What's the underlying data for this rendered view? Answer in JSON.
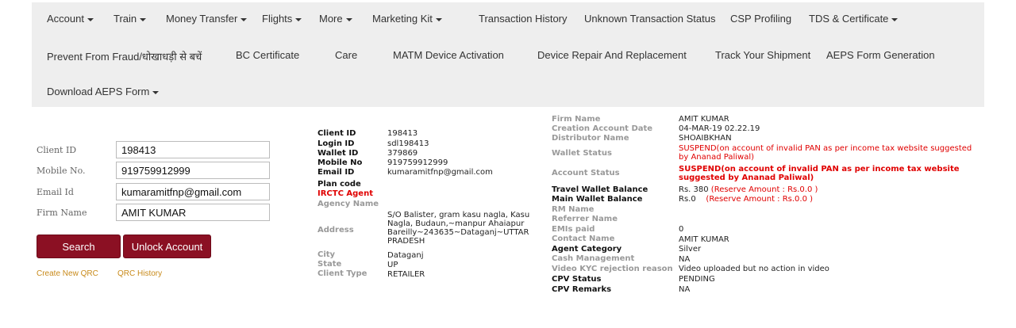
{
  "nav": {
    "row1": [
      {
        "label": "Account",
        "caret": true
      },
      {
        "label": "Train",
        "caret": true
      },
      {
        "label": "Money Transfer",
        "caret": true
      },
      {
        "label": "Flights",
        "caret": true
      },
      {
        "label": "More",
        "caret": true
      },
      {
        "label": "Marketing Kit",
        "caret": true
      },
      {
        "label": "Transaction History",
        "caret": false
      },
      {
        "label": "Unknown Transaction Status",
        "caret": false
      },
      {
        "label": "CSP Profiling",
        "caret": false
      },
      {
        "label": "TDS & Certificate",
        "caret": true
      }
    ],
    "row2": [
      {
        "label": "Prevent From Fraud/धोखाधड़ी से बचें"
      },
      {
        "label": "BC Certificate"
      },
      {
        "label": "Care"
      },
      {
        "label": "MATM Device Activation"
      },
      {
        "label": "Device Repair And Replacement"
      },
      {
        "label": "Track Your Shipment"
      },
      {
        "label": "AEPS Form Generation"
      }
    ],
    "row3": [
      {
        "label": "Download AEPS Form",
        "caret": true
      }
    ]
  },
  "search_form": {
    "client_id_label": "Client ID",
    "client_id_value": "198413",
    "mobile_label": "Mobile No.",
    "mobile_value": "919759912999",
    "email_label": "Email Id",
    "email_value": "kumaramitfnp@gmail.com",
    "firm_label": "Firm Name",
    "firm_value": "AMIT KUMAR",
    "search_button": "Search",
    "unlock_button": "Unlock Account",
    "create_qrc_link": "Create New QRC",
    "qrc_history_link": "QRC History"
  },
  "details_mid": {
    "client_id_k": "Client ID",
    "client_id_v": "198413",
    "login_id_k": "Login ID",
    "login_id_v": "sdl198413",
    "wallet_id_k": "Wallet ID",
    "wallet_id_v": "379869",
    "mobile_k": "Mobile No",
    "mobile_v": "919759912999",
    "email_k": "Email ID",
    "email_v": "kumaramitfnp@gmail.com",
    "plan_k": "Plan code",
    "irctc_k": "IRCTC Agent",
    "agency_k": "Agency Name",
    "address_k": "Address",
    "address_v": "S/O Balister, gram kasu nagla, Kasu Nagla, Budaun,~manpur Ahaiapur Bareilly~243635~Dataganj~UTTAR PRADESH",
    "city_k": "City",
    "city_v": "Dataganj",
    "state_k": "State",
    "state_v": "UP",
    "client_type_k": "Client Type",
    "client_type_v": "RETAILER"
  },
  "details_right": {
    "firm_k": "Firm Name",
    "firm_v": "AMIT KUMAR",
    "creation_k": "Creation Account Date",
    "creation_v": "04-MAR-19 02.22.19",
    "distributor_k": "Distributor Name",
    "distributor_v": "SHOAIBKHAN",
    "wallet_status_k": "Wallet Status",
    "wallet_status_v": "SUSPEND(on account of invalid PAN as per income tax website suggested by Ananad Paliwal)",
    "account_status_k": "Account Status",
    "account_status_v": "SUSPEND(on account of invalid PAN as per income tax website suggested by Ananad Paliwal)",
    "travel_k": "Travel Wallet Balance",
    "travel_v": "Rs. 380",
    "travel_reserve": "(Reserve Amount : Rs.0.0 )",
    "main_k": "Main Wallet Balance",
    "main_v": "Rs.0",
    "main_reserve": "(Reserve Amount : Rs.0.0 )",
    "rm_k": "RM Name",
    "referrer_k": "Referrer Name",
    "emis_k": "EMIs paid",
    "emis_v": "0",
    "contact_k": "Contact Name",
    "contact_v": "AMIT KUMAR",
    "agent_cat_k": "Agent Category",
    "agent_cat_v": "Silver",
    "cash_k": "Cash Management",
    "cash_v": "NA",
    "kyc_k": "Video KYC rejection reason",
    "kyc_v": "Video uploaded but no action in video",
    "cpv_status_k": "CPV Status",
    "cpv_status_v": "PENDING",
    "cpv_remarks_k": "CPV Remarks",
    "cpv_remarks_v": "NA"
  }
}
